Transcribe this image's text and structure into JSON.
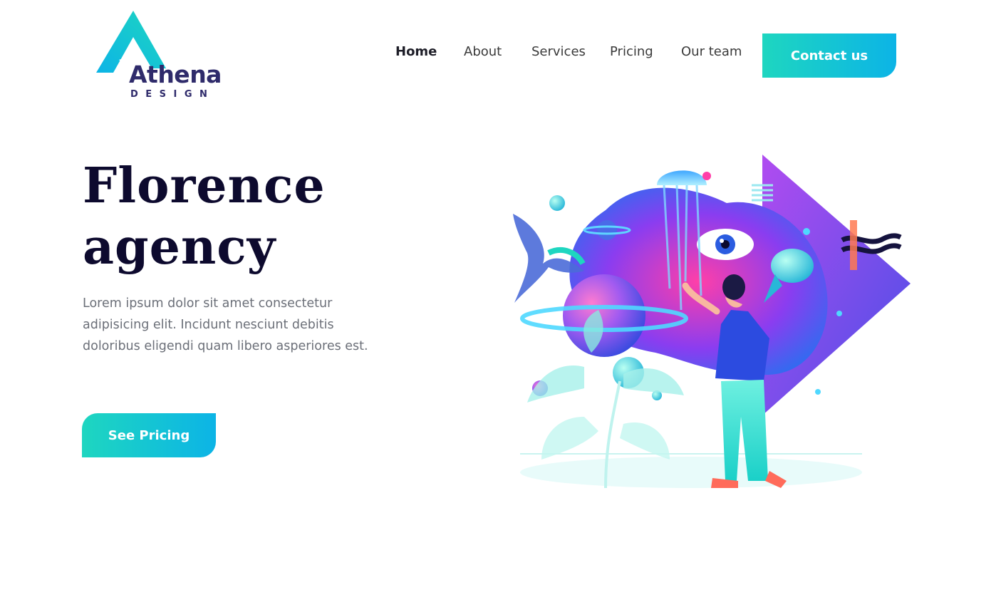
{
  "brand": {
    "name": "Athena",
    "tagline": "DESIGN",
    "logo_colors": [
      "#1ed6c0",
      "#0cb4e6",
      "#2f2b6b"
    ]
  },
  "nav": {
    "items": [
      {
        "label": "Home",
        "active": true
      },
      {
        "label": "About",
        "active": false
      },
      {
        "label": "Services",
        "active": false
      },
      {
        "label": "Pricing",
        "active": false
      },
      {
        "label": "Our team",
        "active": false
      }
    ],
    "cta_label": "Contact us"
  },
  "hero": {
    "title_line1": "Florence",
    "title_line2": "agency",
    "description": "Lorem ipsum dolor sit amet consectetur adipisicing elit. Incidunt nesciunt debitis doloribus eligendi quam libero asperiores est.",
    "cta_label": "See Pricing",
    "illustration": "surreal-ocean-space-illustration"
  },
  "colors": {
    "accent_start": "#1ed6c0",
    "accent_end": "#0cb4e6",
    "title": "#0d0a2e",
    "body_text": "#6b6f78"
  }
}
